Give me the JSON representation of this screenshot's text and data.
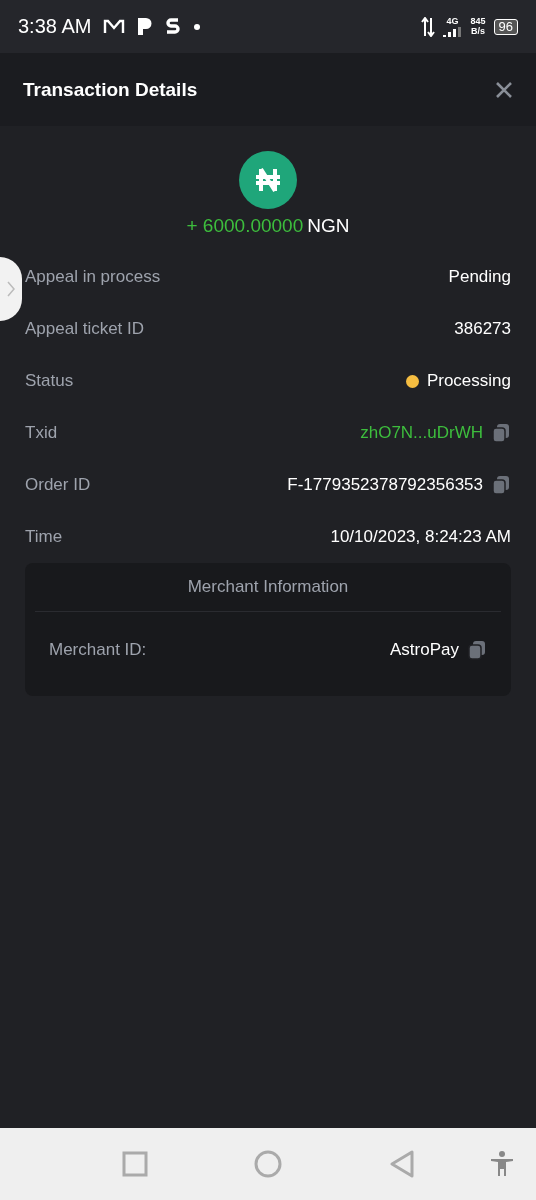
{
  "status_bar": {
    "time": "3:38 AM",
    "network": "4G",
    "speed_value": "845",
    "speed_unit": "B/s",
    "battery": "96"
  },
  "header": {
    "title": "Transaction Details"
  },
  "amount": {
    "sign_value": "+ 6000.00000",
    "currency": "NGN"
  },
  "rows": [
    {
      "kind": "text",
      "label": "Appeal in process",
      "value": "Pending"
    },
    {
      "kind": "text",
      "label": "Appeal ticket ID",
      "value": "386273"
    },
    {
      "kind": "status",
      "label": "Status",
      "value": "Processing",
      "color": "#f5bd41"
    },
    {
      "kind": "link",
      "label": "Txid",
      "value": "zhO7N...uDrWH"
    },
    {
      "kind": "copy",
      "label": "Order ID",
      "value": "F-1779352378792356353"
    },
    {
      "kind": "text",
      "label": "Time",
      "value": "10/10/2023, 8:24:23 AM"
    }
  ],
  "merchant": {
    "title": "Merchant Information",
    "label": "Merchant ID:",
    "value": "AstroPay"
  }
}
